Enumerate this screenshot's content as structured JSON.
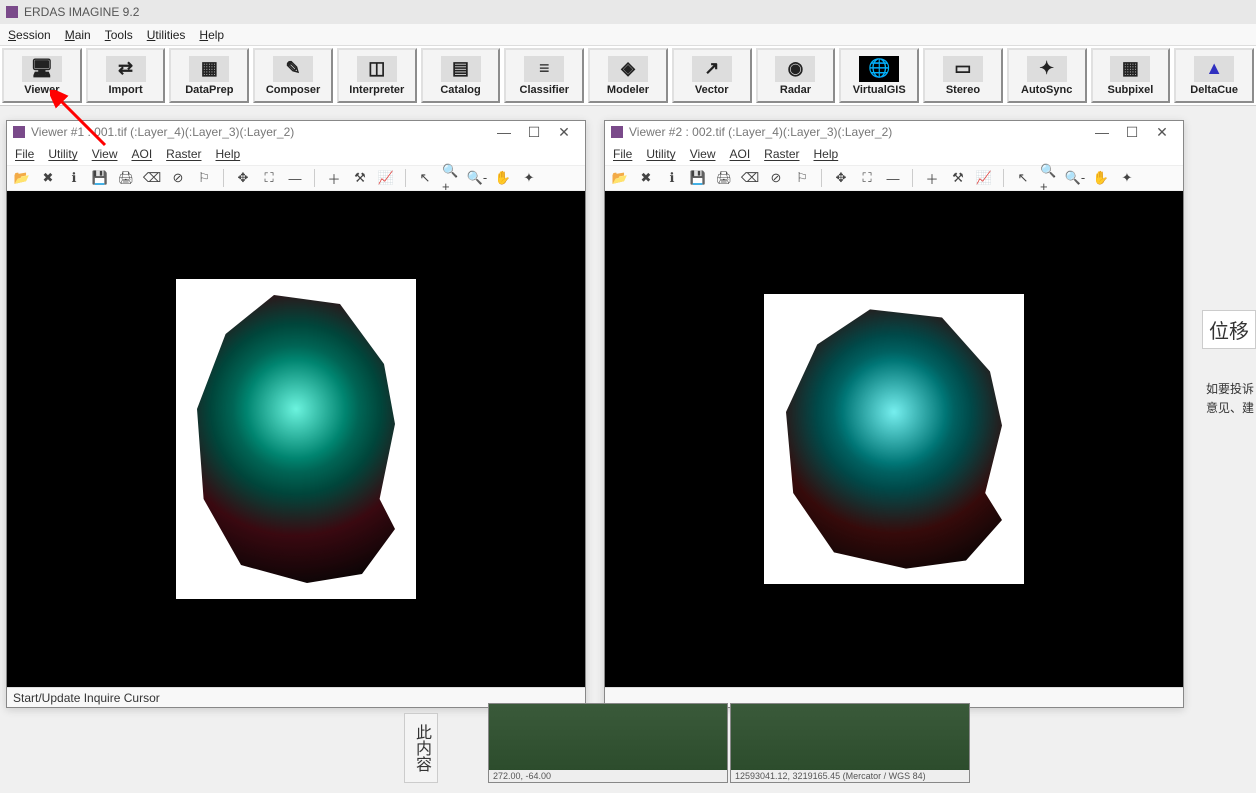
{
  "app": {
    "title": "ERDAS IMAGINE 9.2"
  },
  "mainmenu": [
    "Session",
    "Main",
    "Tools",
    "Utilities",
    "Help"
  ],
  "toolbar": [
    {
      "label": "Viewer",
      "glyph": "🖥"
    },
    {
      "label": "Import",
      "glyph": "⇄"
    },
    {
      "label": "DataPrep",
      "glyph": "▦"
    },
    {
      "label": "Composer",
      "glyph": "✎"
    },
    {
      "label": "Interpreter",
      "glyph": "◫"
    },
    {
      "label": "Catalog",
      "glyph": "▤"
    },
    {
      "label": "Classifier",
      "glyph": "≡"
    },
    {
      "label": "Modeler",
      "glyph": "◈"
    },
    {
      "label": "Vector",
      "glyph": "↗"
    },
    {
      "label": "Radar",
      "glyph": "◉"
    },
    {
      "label": "VirtualGIS",
      "glyph": "🌐"
    },
    {
      "label": "Stereo",
      "glyph": "▭"
    },
    {
      "label": "AutoSync",
      "glyph": "✦"
    },
    {
      "label": "Subpixel",
      "glyph": "▦"
    },
    {
      "label": "DeltaCue",
      "glyph": "▲"
    }
  ],
  "viewer1": {
    "title": "Viewer #1 : 001.tif (:Layer_4)(:Layer_3)(:Layer_2)",
    "menu": [
      "File",
      "Utility",
      "View",
      "AOI",
      "Raster",
      "Help"
    ],
    "status": "Start/Update Inquire Cursor"
  },
  "viewer2": {
    "title": "Viewer #2 : 002.tif (:Layer_4)(:Layer_3)(:Layer_2)",
    "menu": [
      "File",
      "Utility",
      "View",
      "AOI",
      "Raster",
      "Help"
    ],
    "status": ""
  },
  "viewer_tools": [
    {
      "name": "open-icon",
      "g": "📂"
    },
    {
      "name": "close-icon",
      "g": "✖"
    },
    {
      "name": "info-icon",
      "g": "ℹ"
    },
    {
      "name": "save-icon",
      "g": "💾"
    },
    {
      "name": "print-icon",
      "g": "🖨"
    },
    {
      "name": "erase-icon",
      "g": "⌫"
    },
    {
      "name": "no-entry-icon",
      "g": "⊘"
    },
    {
      "name": "marker-icon",
      "g": "⚐"
    },
    {
      "name": "sep",
      "g": ""
    },
    {
      "name": "fit-in-icon",
      "g": "✥"
    },
    {
      "name": "fit-out-icon",
      "g": "⛶"
    },
    {
      "name": "measure-icon",
      "g": "―"
    },
    {
      "name": "sep",
      "g": ""
    },
    {
      "name": "crosshair-icon",
      "g": "＋"
    },
    {
      "name": "hammer-icon",
      "g": "⚒"
    },
    {
      "name": "profile-icon",
      "g": "📈"
    },
    {
      "name": "sep",
      "g": ""
    },
    {
      "name": "pointer-icon",
      "g": "↖"
    },
    {
      "name": "zoom-in-icon",
      "g": "🔍+"
    },
    {
      "name": "zoom-out-icon",
      "g": "🔍-"
    },
    {
      "name": "pan-icon",
      "g": "✋"
    },
    {
      "name": "roam-icon",
      "g": "✦"
    }
  ],
  "side": {
    "button": "位移",
    "note": "如要投诉\n意见、建"
  },
  "thumb1_caption": "272.00, -64.00",
  "thumb2_caption": "12593041.12, 3219165.45   (Mercator / WGS 84)",
  "cn_label": "此内容"
}
